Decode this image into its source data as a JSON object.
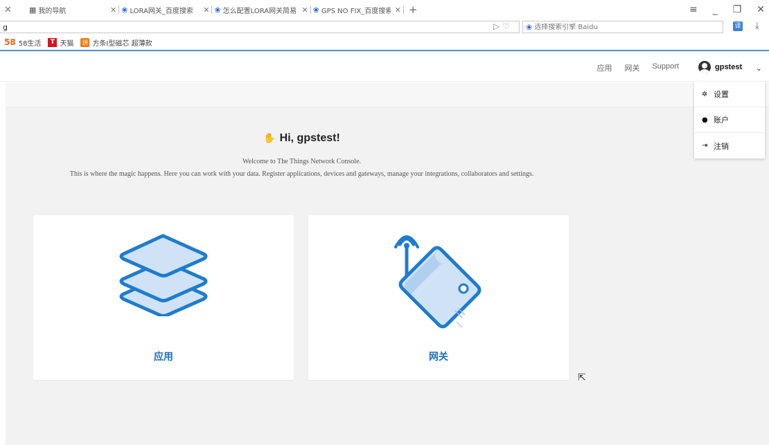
{
  "browser": {
    "tabs": [
      {
        "label": "我的导航",
        "icon": "grid-icon"
      },
      {
        "label": "LORA网关_百度搜索",
        "icon": "baidu-paw-icon"
      },
      {
        "label": "怎么配置LORA网关简易",
        "icon": "baidu-paw-icon"
      },
      {
        "label": "GPS NO FIX_百度搜索",
        "icon": "baidu-paw-icon"
      }
    ],
    "url": "g",
    "search_placeholder": "选择搜索引擎 Baidu",
    "bookmarks": [
      {
        "label": "58生活",
        "badge": "58"
      },
      {
        "label": "天猫",
        "badge": "T"
      },
      {
        "label": "方条I型磁芯 超薄款",
        "badge": "拼"
      }
    ]
  },
  "header": {
    "nav": [
      "应用",
      "网关",
      "Support"
    ],
    "username": "gpstest"
  },
  "dropdown": {
    "items": [
      {
        "label": "设置",
        "icon": "gear-icon"
      },
      {
        "label": "账户",
        "icon": "user-icon"
      },
      {
        "label": "注销",
        "icon": "logout-icon"
      }
    ]
  },
  "main": {
    "greeting": "Hi, gpstest!",
    "welcome": "Welcome to The Things Network Console.",
    "description": "This is where the magic happens. Here you can work with your data. Register applications, devices and gateways, manage your integrations, collaborators and settings.",
    "cards": [
      {
        "label": "应用",
        "icon": "stacked-layers-icon"
      },
      {
        "label": "网关",
        "icon": "gateway-device-icon"
      }
    ]
  },
  "colors": {
    "accent": "#1a6fc0",
    "icon_fill": "#cfe2f6",
    "icon_stroke": "#1f7ccc",
    "page_bg": "#f2f2f2"
  }
}
